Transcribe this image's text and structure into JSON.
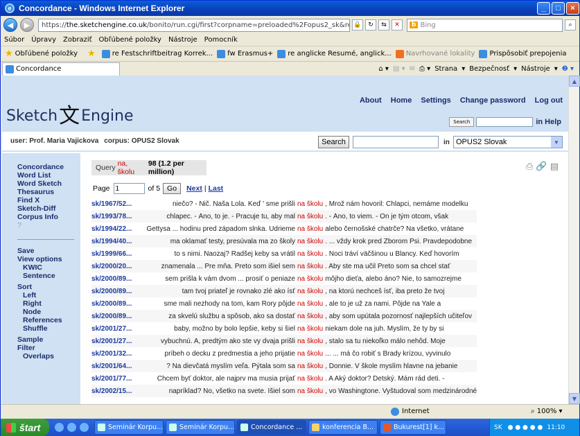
{
  "window": {
    "title": "Concordance - Windows Internet Explorer"
  },
  "address": {
    "prefix": "https://",
    "host": "the.sketchengine.co.uk",
    "path": "/bonito/run.cgi/first?corpname=preloaded%2Fopus2_sk&reload="
  },
  "bing": {
    "placeholder": "Bing"
  },
  "menu": [
    "Súbor",
    "Úpravy",
    "Zobraziť",
    "Obľúbené položky",
    "Nástroje",
    "Pomocník"
  ],
  "favorites": {
    "label": "Obľúbené položky",
    "items": [
      "re Festschriftbeitrag Korrek...",
      "fw Erasmus+",
      "re anglicke Resumé, anglick...",
      "Navrhované lokality",
      "Prispôsobiť prepojenia"
    ]
  },
  "tab": {
    "label": "Concordance"
  },
  "tabtools": {
    "page": "Strana",
    "safety": "Bezpečnosť",
    "tools": "Nástroje"
  },
  "header": {
    "logo_left": "Sketch",
    "logo_right": "Engine",
    "links": [
      "About",
      "Home",
      "Settings",
      "Change password",
      "Log out"
    ],
    "search_btn": "Search",
    "in_help": "in Help"
  },
  "userbar": {
    "user": "user: Prof. Maria Vajickova",
    "corpus": "corpus: OPUS2 Slovak",
    "search_btn": "Search",
    "in_label": "in",
    "corpus_select": "OPUS2 Slovak"
  },
  "sidebar": {
    "top": [
      "Concordance",
      "Word List",
      "Word Sketch",
      "Thesaurus",
      "Find X",
      "Sketch-Diff",
      "Corpus Info"
    ],
    "help": "?",
    "save": "Save",
    "view_options": "View options",
    "view_sub": [
      "KWIC",
      "Sentence"
    ],
    "sort": "Sort",
    "sort_sub": [
      "Left",
      "Right",
      "Node",
      "References",
      "Shuffle"
    ],
    "sample": "Sample",
    "filter": "Filter",
    "overlaps": "Overlaps"
  },
  "query": {
    "label": "Query",
    "term": "na, školu",
    "count": "98 (1.2 per million)"
  },
  "pager": {
    "page_label": "Page",
    "page_value": "1",
    "of": "of 5",
    "go": "Go",
    "next": "Next",
    "sep": "|",
    "last": "Last"
  },
  "rows": [
    {
      "ref": "sk/1967/52...",
      "left": "niečo? - Nič. Naša Lola. Keď ' sme prišli",
      "kwic": "na školu",
      "right": ", Mrož nám hovoril: Chlapci, nemáme modelku"
    },
    {
      "ref": "sk/1993/78...",
      "left": "chlapec. - Áno, to je. - Pracuje tu, aby mal",
      "kwic": "na školu",
      "right": ". - Áno, to viem. - On je tým otcom, však"
    },
    {
      "ref": "sk/1994/22...",
      "left": "Gettysa ... hodinu pred západom slnka. Udrieme",
      "kwic": "na školu",
      "right": "alebo černošské chatrče? Na všetko, vrátane"
    },
    {
      "ref": "sk/1994/40...",
      "left": "ma oklamať testy, presúvala ma zo školy",
      "kwic": "na školu",
      "right": ". ... vždy krok pred Zborom Psi. Pravdepodobne"
    },
    {
      "ref": "sk/1999/66...",
      "left": "to s nimi. Naozaj? Radšej keby sa vrátil",
      "kwic": "na školu",
      "right": ". Noci tráví väčšinou u Blancy. Keď hovorím"
    },
    {
      "ref": "sk/2000/20...",
      "left": "znamenala ... Pre mňa. Preto som išiel sem",
      "kwic": "na školu",
      "right": ". Aby ste ma učil Preto som sa chcel stať"
    },
    {
      "ref": "sk/2000/89...",
      "left": "sem prišla k vám dvom ... prosiť o peniaze",
      "kwic": "na školu",
      "right": "môjho dieťa, alebo áno? Nie, to samozrejme"
    },
    {
      "ref": "sk/2000/89...",
      "left": "tam tvoj priateľ je rovnako zlé ako ísť",
      "kwic": "na školu",
      "right": ", na ktorú nechceš ísť, iba preto že tvoj"
    },
    {
      "ref": "sk/2000/89...",
      "left": "sme mali nezhody na tom, kam Rory pôjde",
      "kwic": "na školu",
      "right": ", ale to je už za nami. Pôjde na Yale a"
    },
    {
      "ref": "sk/2000/89...",
      "left": "za skvelú službu a spôsob, ako sa dostať",
      "kwic": "na školu",
      "right": ", aby som upútala pozornosť najlepších učiteľov"
    },
    {
      "ref": "sk/2001/27...",
      "left": "baby, možno by bolo lepšie, keby si šiel",
      "kwic": "na školu",
      "right": "niekam dole na juh. Myslím, že ty by si"
    },
    {
      "ref": "sk/2001/27...",
      "left": "vybuchnú. A, predtým ako ste vy dvaja prišli",
      "kwic": "na školu",
      "right": ", stalo sa tu niekoľko málo nehôd. Moje"
    },
    {
      "ref": "sk/2001/32...",
      "left": "príbeh o decku z predmestia a jeho prijatie",
      "kwic": "na školu",
      "right": "... ... má čo robiť s Brady krízou, vyvinulo"
    },
    {
      "ref": "sk/2001/64...",
      "left": "? Na dievčatá myslím veľa. Pýtala som sa",
      "kwic": "na školu",
      "right": ", Donnie. V škole myslím hlavne na jebanie"
    },
    {
      "ref": "sk/2001/77...",
      "left": "Chcem byť doktor, ale najprv ma musia prijať",
      "kwic": "na školu",
      "right": ". A Aký doktor? Detský. Mám rád deti. -"
    },
    {
      "ref": "sk/2002/15...",
      "left": "napríklad? No, všetko na svete. Išiel som",
      "kwic": "na školu",
      "right": ", vo Washingtone. Vyštudoval som medzinárodné"
    }
  ],
  "status": {
    "zone": "Internet",
    "zoom": "100%"
  },
  "taskbar": {
    "start": "štart",
    "tasks": [
      "Seminár Korpu...",
      "Seminár Korpu...",
      "Concordance ...",
      "konferencia B...",
      "Bukurest[1] k..."
    ],
    "lang": "SK",
    "time": "11:10"
  }
}
